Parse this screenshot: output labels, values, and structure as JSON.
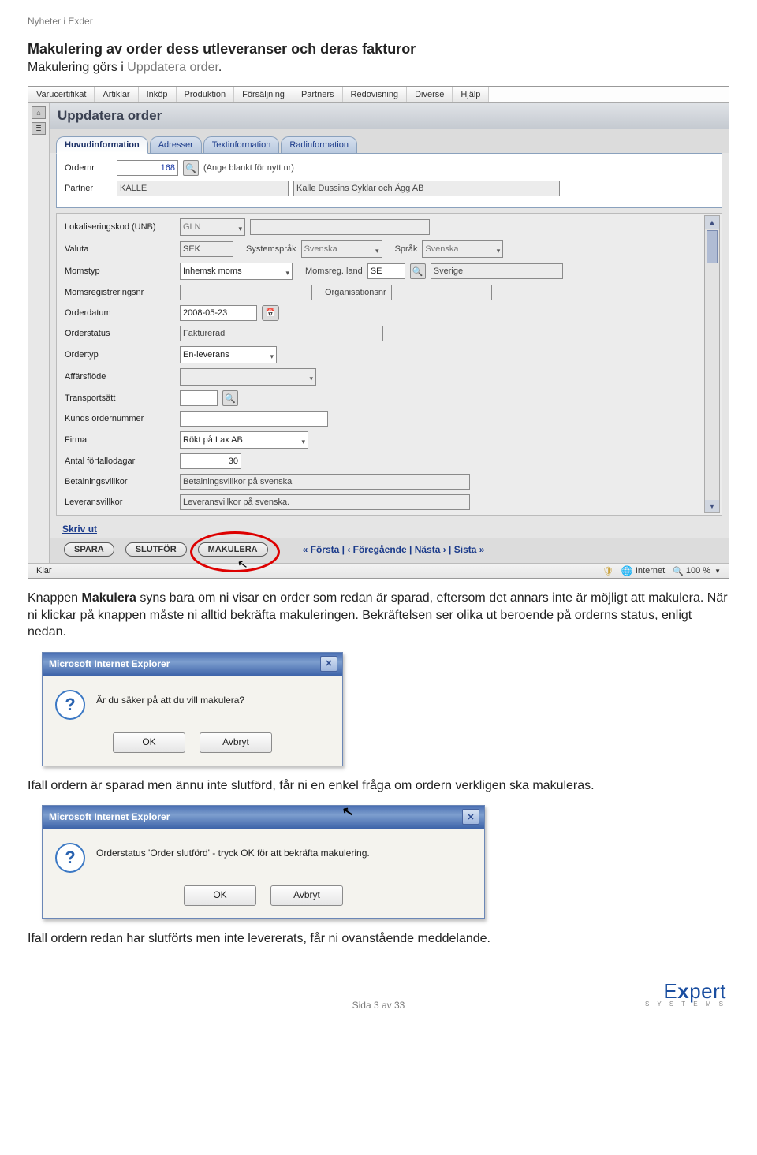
{
  "doc": {
    "subtitle": "Nyheter i Exder",
    "heading": "Makulering av order dess utleveranser och deras fakturor",
    "intro_pre": "Makulering görs i ",
    "intro_link": "Uppdatera order",
    "intro_post": ".",
    "para1_pre": "Knappen ",
    "para1_bold": "Makulera",
    "para1_post": " syns bara om ni visar en order som redan är sparad, eftersom det annars inte är möjligt att makulera. När ni klickar på knappen måste ni alltid bekräfta makuleringen. Bekräftelsen ser olika ut beroende på orderns status, enligt nedan.",
    "para2": "Ifall ordern är sparad men ännu inte slutförd, får ni en enkel fråga om ordern verkligen ska makuleras.",
    "para3": "Ifall ordern redan har slutförts men inte levererats, får ni ovanstående meddelande."
  },
  "menu": {
    "items": [
      "Varucertifikat",
      "Artiklar",
      "Inköp",
      "Produktion",
      "Försäljning",
      "Partners",
      "Redovisning",
      "Diverse",
      "Hjälp"
    ]
  },
  "pageTitle": "Uppdatera order",
  "tabs": [
    "Huvudinformation",
    "Adresser",
    "Textinformation",
    "Radinformation"
  ],
  "form": {
    "ordernr_label": "Ordernr",
    "ordernr_value": "168",
    "ordernr_hint": "(Ange blankt för nytt nr)",
    "partner_label": "Partner",
    "partner_code": "KALLE",
    "partner_name": "Kalle Dussins Cyklar och Ägg AB",
    "lokaliseringskod_label": "Lokaliseringskod (UNB)",
    "lokaliseringskod_type": "GLN",
    "valuta_label": "Valuta",
    "valuta_value": "SEK",
    "systemsprak_label": "Systemspråk",
    "systemsprak_value": "Svenska",
    "sprak_label": "Språk",
    "sprak_value": "Svenska",
    "momstyp_label": "Momstyp",
    "momstyp_value": "Inhemsk moms",
    "momsreg_land_label": "Momsreg. land",
    "momsreg_land_code": "SE",
    "momsreg_land_name": "Sverige",
    "momsregnr_label": "Momsregistreringsnr",
    "orgnr_label": "Organisationsnr",
    "orderdatum_label": "Orderdatum",
    "orderdatum_value": "2008-05-23",
    "orderstatus_label": "Orderstatus",
    "orderstatus_value": "Fakturerad",
    "ordertyp_label": "Ordertyp",
    "ordertyp_value": "En-leverans",
    "affarsflode_label": "Affärsflöde",
    "transportsatt_label": "Transportsätt",
    "kunds_ordernr_label": "Kunds ordernummer",
    "firma_label": "Firma",
    "firma_value": "Rökt på Lax AB",
    "forfallodagar_label": "Antal förfallodagar",
    "forfallodagar_value": "30",
    "betalningsvillkor_label": "Betalningsvillkor",
    "betalningsvillkor_value": "Betalningsvillkor på svenska",
    "leveransvillkor_label": "Leveransvillkor",
    "leveransvillkor_value": "Leveransvillkor på svenska."
  },
  "actions": {
    "print": "Skriv ut",
    "spara": "SPARA",
    "slutfor": "SLUTFÖR",
    "makulera": "MAKULERA",
    "nav": "«  Första  |  ‹  Föregående  |  Nästa  ›  |  Sista  »"
  },
  "status": {
    "left": "Klar",
    "internet": "Internet",
    "zoom": "100 %"
  },
  "dialog1": {
    "title": "Microsoft Internet Explorer",
    "msg": "Är du säker på att du vill makulera?",
    "ok": "OK",
    "cancel": "Avbryt"
  },
  "dialog2": {
    "title": "Microsoft Internet Explorer",
    "msg": "Orderstatus 'Order slutförd' - tryck OK för att bekräfta makulering.",
    "ok": "OK",
    "cancel": "Avbryt"
  },
  "footer": {
    "pagenum": "Sida 3 av 33",
    "logo_main_pre": "E",
    "logo_main_x": "x",
    "logo_main_post": "pert",
    "logo_sub": "S Y S T E M S"
  }
}
